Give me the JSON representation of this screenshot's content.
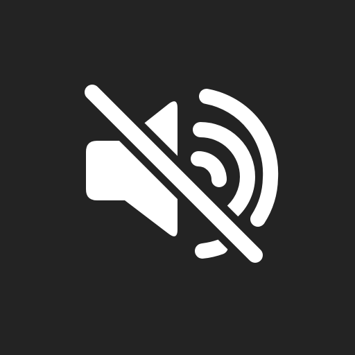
{
  "icon": {
    "name": "volume-mute-icon",
    "foreground_color": "#ffffff",
    "background_color": "#232323"
  }
}
